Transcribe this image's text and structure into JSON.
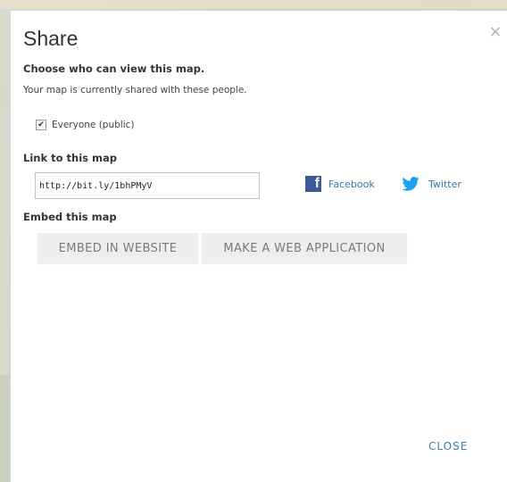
{
  "dialog": {
    "title": "Share",
    "close_glyph": "×",
    "who_heading": "Choose who can view this map.",
    "shared_text": "Your map is currently shared with these people.",
    "everyone": {
      "label": "Everyone (public)",
      "checked": true
    },
    "link_heading": "Link to this map",
    "link_value": "http://bit.ly/1bhPMyV",
    "facebook_label": "Facebook",
    "twitter_label": "Twitter",
    "embed_heading": "Embed this map",
    "embed_website_label": "EMBED IN WEBSITE",
    "web_app_label": "MAKE A WEB APPLICATION",
    "close_label": "CLOSE"
  },
  "colors": {
    "link": "#3a7fb5",
    "facebook": "#3b5998",
    "twitter": "#1da1f2",
    "button_bg": "#eeeeee",
    "button_text": "#7a7a7a"
  }
}
